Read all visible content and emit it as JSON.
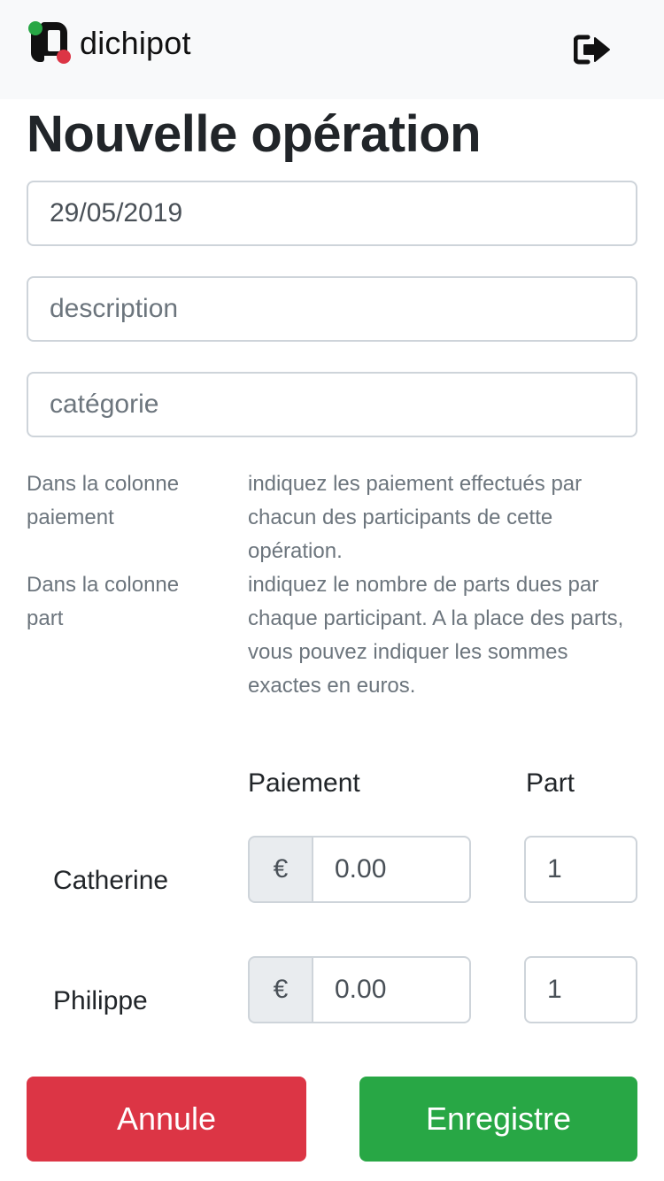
{
  "header": {
    "brand": "dichipot",
    "logo_icon": "dichipot-logo-icon",
    "logout_icon": "sign-out-icon"
  },
  "page": {
    "title": "Nouvelle opération"
  },
  "form": {
    "date_value": "29/05/2019",
    "description_placeholder": "description",
    "category_placeholder": "catégorie"
  },
  "help": [
    {
      "label": "Dans la colonne paiement",
      "text": "indiquez les paiement effectués par chacun des participants de cette opération."
    },
    {
      "label": "Dans la colonne part",
      "text": "indiquez le nombre de parts dues par chaque participant. A la place des parts, vous pouvez indiquer les sommes exactes en euros."
    }
  ],
  "table": {
    "payment_header": "Paiement",
    "part_header": "Part",
    "currency": "€",
    "participants": [
      {
        "name": "Catherine",
        "payment": "0.00",
        "part": "1"
      },
      {
        "name": "Philippe",
        "payment": "0.00",
        "part": "1"
      }
    ]
  },
  "actions": {
    "cancel_label": "Annule",
    "save_label": "Enregistre"
  },
  "colors": {
    "danger": "#dc3545",
    "success": "#28a745",
    "navbar_bg": "#f8f9fa"
  }
}
